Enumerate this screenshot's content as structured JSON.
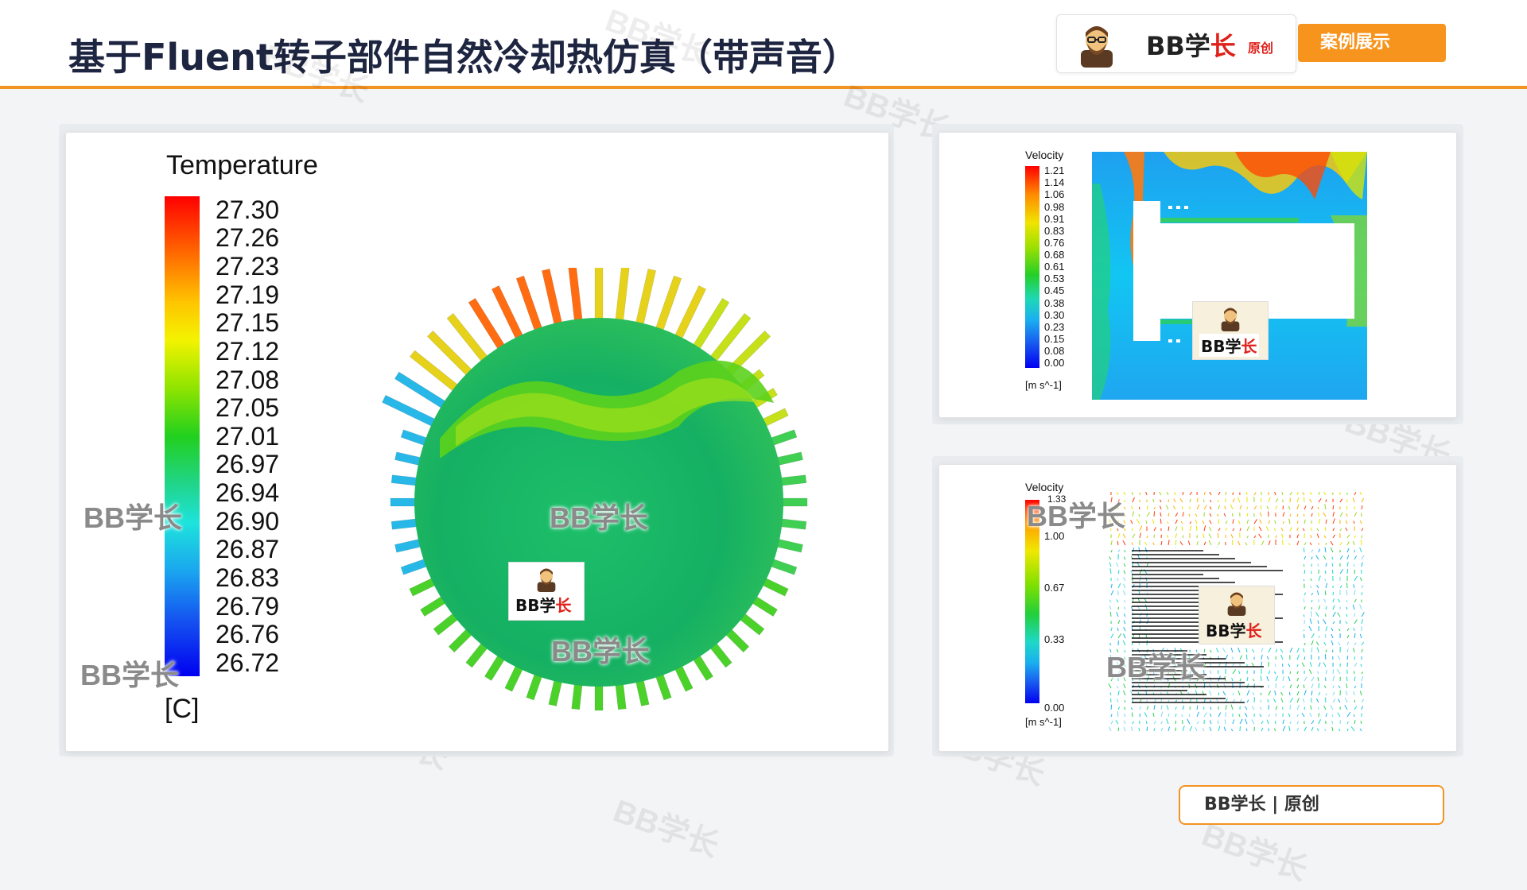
{
  "page": {
    "title": "基于Fluent转子部件自然冷却热仿真（带声音）",
    "accent_color": "#f39323"
  },
  "brand": {
    "name_black": "BB学",
    "name_red": "长",
    "sub": "原创",
    "button": "案例展示"
  },
  "watermark": {
    "text": "BB学长"
  },
  "temperature_panel": {
    "legend_title": "Temperature",
    "unit": "[C]",
    "ticks": [
      "27.30",
      "27.26",
      "27.23",
      "27.19",
      "27.15",
      "27.12",
      "27.08",
      "27.05",
      "27.01",
      "26.97",
      "26.94",
      "26.90",
      "26.87",
      "26.83",
      "26.79",
      "26.76",
      "26.72"
    ]
  },
  "velocity_contour_panel": {
    "legend_title": "Velocity",
    "unit": "[m s^-1]",
    "ticks": [
      "1.21",
      "1.14",
      "1.06",
      "0.98",
      "0.91",
      "0.83",
      "0.76",
      "0.68",
      "0.61",
      "0.53",
      "0.45",
      "0.38",
      "0.30",
      "0.23",
      "0.15",
      "0.08",
      "0.00"
    ]
  },
  "velocity_vector_panel": {
    "legend_title": "Velocity",
    "legend_top_partial": "1.33",
    "unit": "[m s^-1]",
    "ticks": [
      "1.00",
      "0.67",
      "0.33",
      "0.00"
    ]
  },
  "footer": {
    "text": "BB学长  |  原创"
  }
}
